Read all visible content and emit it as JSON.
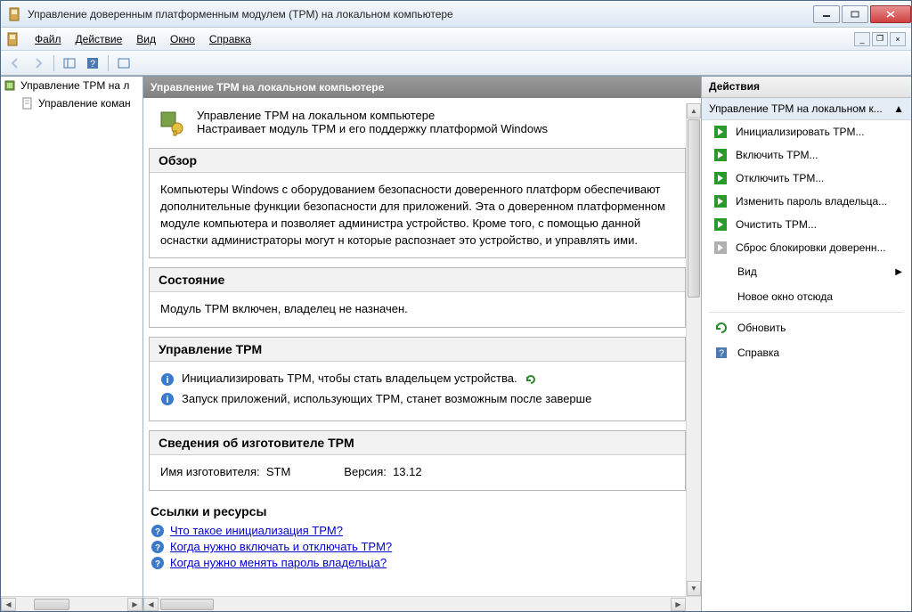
{
  "titlebar": {
    "text": "Управление доверенным платформенным модулем (TPM) на локальном компьютере"
  },
  "menu": {
    "file": "Файл",
    "action": "Действие",
    "view": "Вид",
    "window": "Окно",
    "help": "Справка"
  },
  "tree": {
    "root": "Управление TPM на л",
    "child": "Управление коман"
  },
  "center": {
    "header": "Управление TPM на локальном компьютере",
    "intro_title": "Управление TPM на локальном компьютере",
    "intro_sub": "Настраивает модуль TPM и его поддержку платформой Windows",
    "overview_hd": "Обзор",
    "overview_body": "Компьютеры Windows с оборудованием безопасности доверенного платформ обеспечивают дополнительные функции безопасности для приложений. Эта о доверенном платформенном модуле компьютера и позволяет администра устройство. Кроме того, с помощью данной оснастки администраторы могут н которые распознает это устройство, и управлять ими.",
    "status_hd": "Состояние",
    "status_body": "Модуль TPM включен, владелец не назначен.",
    "manage_hd": "Управление TPM",
    "manage_item1": "Инициализировать TPM, чтобы стать владельцем устройства.",
    "manage_item2": "Запуск приложений, использующих TPM, станет возможным после заверше",
    "mfr_hd": "Сведения об изготовителе TPM",
    "mfr_name_label": "Имя изготовителя:",
    "mfr_name_value": "STM",
    "mfr_ver_label": "Версия:",
    "mfr_ver_value": "13.12",
    "links_hd": "Ссылки и ресурсы",
    "link1": "Что такое инициализация TPM?",
    "link2": "Когда нужно включать и отключать TPM?",
    "link3": "Когда нужно менять пароль владельца?"
  },
  "actions": {
    "header": "Действия",
    "sub": "Управление TPM на локальном к...",
    "items": {
      "init": "Инициализировать TPM...",
      "enable": "Включить TPM...",
      "disable": "Отключить TPM...",
      "chpass": "Изменить пароль владельца...",
      "clear": "Очистить TPM...",
      "reset": "Сброс блокировки доверенн...",
      "view": "Вид",
      "newwin": "Новое окно отсюда",
      "refresh": "Обновить",
      "help": "Справка"
    }
  }
}
